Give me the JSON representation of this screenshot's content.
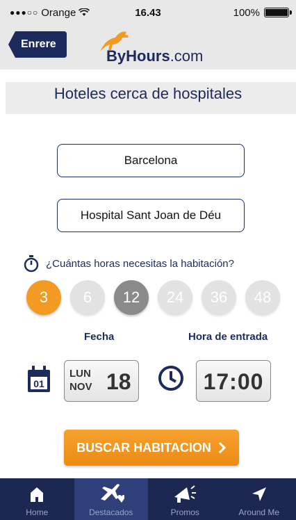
{
  "status_bar": {
    "carrier": "Orange",
    "time": "16.43",
    "battery": "100%",
    "battery_level": 1.0
  },
  "header": {
    "back_label": "Enrere",
    "logo_main": "ByHours",
    "logo_suffix": ".com"
  },
  "page": {
    "title": "Hoteles cerca de hospitales"
  },
  "form": {
    "city_value": "Barcelona",
    "hospital_value": "Hospital Sant Joan de Déu",
    "hours_question": "¿Cuántas horas necesitas la habitación?",
    "hour_options": [
      "3",
      "6",
      "12",
      "24",
      "36",
      "48"
    ],
    "selected_hours": "3",
    "date_label": "Fecha",
    "entry_label": "Hora de entrada",
    "date_weekday": "LUN",
    "date_month": "NOV",
    "date_day": "18",
    "entry_time": "17:00",
    "search_label": "BUSCAR HABITACION"
  },
  "tabs": [
    {
      "label": "Home",
      "icon": "home-icon"
    },
    {
      "label": "Destacados",
      "icon": "featured-icon"
    },
    {
      "label": "Promos",
      "icon": "megaphone-icon"
    },
    {
      "label": "Around Me",
      "icon": "location-arrow-icon"
    }
  ],
  "colors": {
    "navy": "#1c2a5c",
    "orange": "#f29a21",
    "tabbar": "#1c2752",
    "tab_active": "#2e3f7a"
  }
}
